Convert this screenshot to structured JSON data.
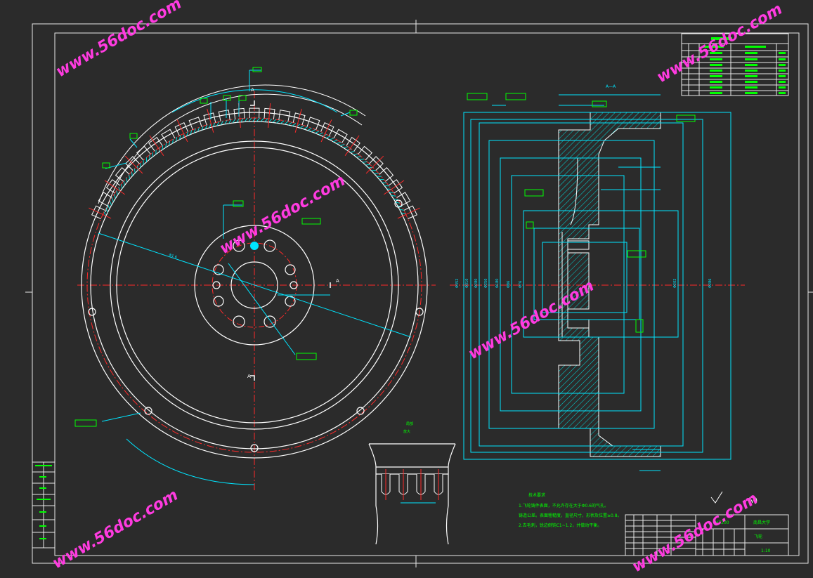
{
  "colors": {
    "background": "#2b2b2b",
    "frame": "#e8e8e8",
    "outline": "#ffffff",
    "dimension": "#00e5ff",
    "annotation": "#00ff00",
    "centerline": "#ff2a2a",
    "hatch": "#00d8d8",
    "watermark": "#ff3be0"
  },
  "watermark": {
    "text": "www.56doc.com"
  },
  "drawing": {
    "left_label_a": "A",
    "left_label_a2": "A",
    "left_label_a3": "A",
    "gear_note": "Φ1.6",
    "section_title": "A—A",
    "section_dims": [
      "Φ352",
      "Φ310",
      "Φ280",
      "Φ250",
      "Φ180",
      "Φ86",
      "Φ76",
      "Φ202",
      "Φ286"
    ],
    "detail_title": "局部",
    "detail_scale": "放大",
    "requirements_title": "技术要求",
    "requirements_lines": [
      "1.飞轮铸件表面，不允许存在大于Φ0.6的气孔。",
      "铸造公差。表面粗糙度，直径尺寸，形状及位置≥0.8。",
      "2.去毛刺，锐边倒钝C1~1.2，并做动平衡。"
    ],
    "roughness_other": "(√)",
    "title_block": {
      "material": "HT200",
      "part_name": "飞轮",
      "school": "南昌大学",
      "scale": "1:10"
    }
  }
}
